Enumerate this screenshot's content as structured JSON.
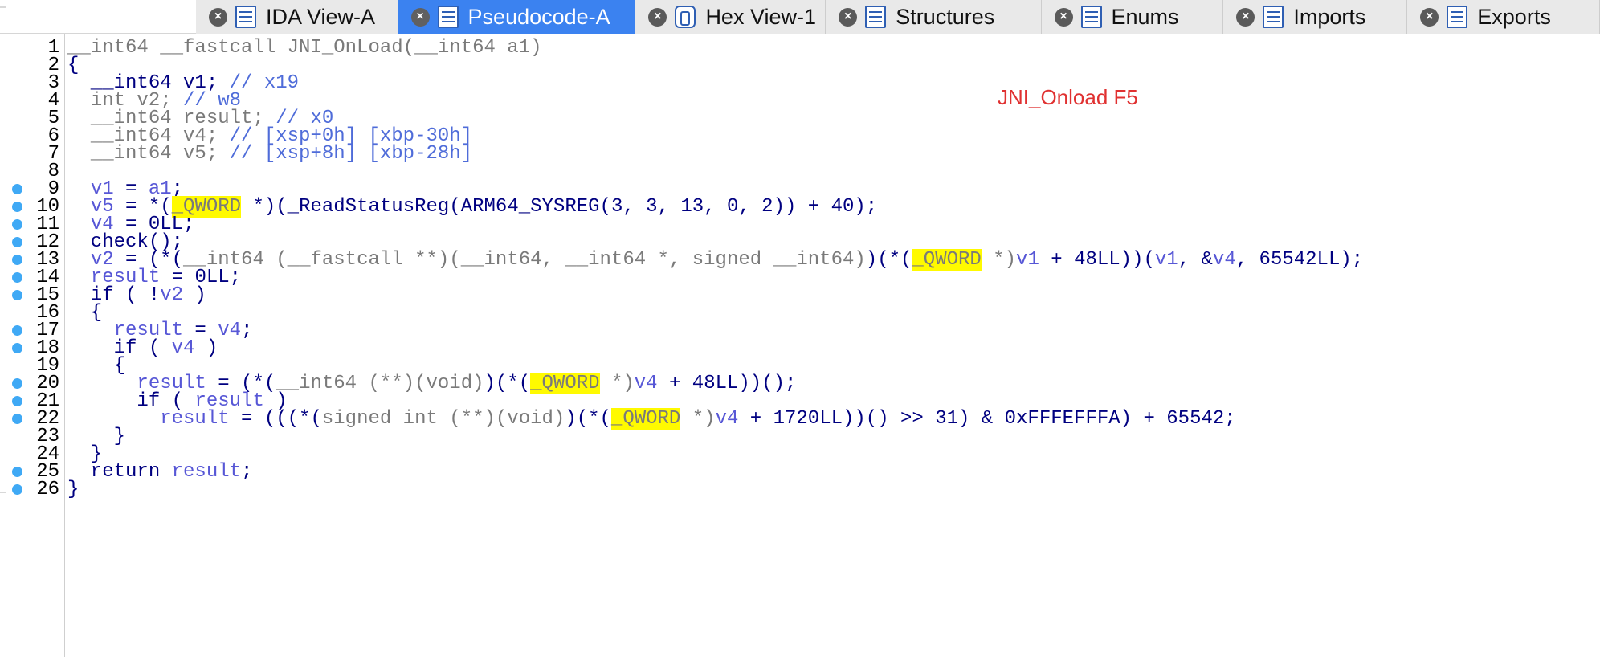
{
  "tabs": [
    {
      "label": "IDA View-A",
      "icon": "ida-view-icon",
      "active": false
    },
    {
      "label": "Pseudocode-A",
      "icon": "pseudocode-icon",
      "active": true
    },
    {
      "label": "Hex View-1",
      "icon": "hex-view-icon",
      "active": false
    },
    {
      "label": "Structures",
      "icon": "structures-icon",
      "active": false
    },
    {
      "label": "Enums",
      "icon": "enums-icon",
      "active": false
    },
    {
      "label": "Imports",
      "icon": "imports-icon",
      "active": false
    },
    {
      "label": "Exports",
      "icon": "exports-icon",
      "active": false
    }
  ],
  "annotation": "JNI_Onload F5",
  "colors": {
    "active_tab": "#3b82f0",
    "breakpoint": "#3fa9f5",
    "highlight": "#fffa00",
    "annotation": "#e03131",
    "keyword": "#000080",
    "variable": "#5757d6",
    "type": "#7a7a7a"
  },
  "code_lines": [
    {
      "n": "1",
      "bp": false,
      "tokens": [
        [
          "__int64 __fastcall JNI_OnLoad(__int64 a1)",
          "grey"
        ]
      ]
    },
    {
      "n": "2",
      "bp": false,
      "tokens": [
        [
          "{",
          "dft"
        ]
      ]
    },
    {
      "n": "3",
      "bp": false,
      "tokens": [
        [
          "  __int64 v1; ",
          "dft"
        ],
        [
          "// x19",
          "cmt"
        ]
      ]
    },
    {
      "n": "4",
      "bp": false,
      "tokens": [
        [
          "  ",
          "dft"
        ],
        [
          "int v2; ",
          "grey"
        ],
        [
          "// w8",
          "cmt"
        ]
      ]
    },
    {
      "n": "5",
      "bp": false,
      "tokens": [
        [
          "  ",
          "dft"
        ],
        [
          "__int64 result; ",
          "grey"
        ],
        [
          "// x0",
          "cmt"
        ]
      ]
    },
    {
      "n": "6",
      "bp": false,
      "tokens": [
        [
          "  ",
          "dft"
        ],
        [
          "__int64 v4; ",
          "grey"
        ],
        [
          "// [xsp+0h] [xbp-30h]",
          "cmt"
        ]
      ]
    },
    {
      "n": "7",
      "bp": false,
      "tokens": [
        [
          "  ",
          "dft"
        ],
        [
          "__int64 v5; ",
          "grey"
        ],
        [
          "// [xsp+8h] [xbp-28h]",
          "cmt"
        ]
      ]
    },
    {
      "n": "8",
      "bp": false,
      "tokens": [
        [
          "",
          "dft"
        ]
      ]
    },
    {
      "n": "9",
      "bp": true,
      "tokens": [
        [
          "  ",
          "dft"
        ],
        [
          "v1",
          "var"
        ],
        [
          " = ",
          "dft"
        ],
        [
          "a1",
          "var"
        ],
        [
          ";",
          "dft"
        ]
      ]
    },
    {
      "n": "10",
      "bp": true,
      "tokens": [
        [
          "  ",
          "dft"
        ],
        [
          "v5",
          "var"
        ],
        [
          " = *(",
          "dft"
        ],
        [
          "_QWORD",
          "hl"
        ],
        [
          " *)(_ReadStatusReg(ARM64_SYSREG(3, 3, 13, 0, 2)) + 40);",
          "dft"
        ]
      ]
    },
    {
      "n": "11",
      "bp": true,
      "tokens": [
        [
          "  ",
          "dft"
        ],
        [
          "v4",
          "var"
        ],
        [
          " = 0LL;",
          "dft"
        ]
      ]
    },
    {
      "n": "12",
      "bp": true,
      "tokens": [
        [
          "  check();",
          "dft"
        ]
      ]
    },
    {
      "n": "13",
      "bp": true,
      "tokens": [
        [
          "  ",
          "dft"
        ],
        [
          "v2",
          "var"
        ],
        [
          " = (*(",
          "dft"
        ],
        [
          "__int64 (__fastcall **)(__int64, __int64 *, signed __int64)",
          "grey"
        ],
        [
          ")(*(",
          "dft"
        ],
        [
          "_QWORD",
          "hl"
        ],
        [
          " *)",
          "grey"
        ],
        [
          "v1",
          "var"
        ],
        [
          " + 48LL))(",
          "dft"
        ],
        [
          "v1",
          "var"
        ],
        [
          ", &",
          "dft"
        ],
        [
          "v4",
          "var"
        ],
        [
          ", 65542LL);",
          "dft"
        ]
      ]
    },
    {
      "n": "14",
      "bp": true,
      "tokens": [
        [
          "  ",
          "dft"
        ],
        [
          "result",
          "var"
        ],
        [
          " = 0LL;",
          "dft"
        ]
      ]
    },
    {
      "n": "15",
      "bp": true,
      "tokens": [
        [
          "  if ( !",
          "dft"
        ],
        [
          "v2",
          "var"
        ],
        [
          " )",
          "dft"
        ]
      ]
    },
    {
      "n": "16",
      "bp": false,
      "tokens": [
        [
          "  {",
          "dft"
        ]
      ]
    },
    {
      "n": "17",
      "bp": true,
      "tokens": [
        [
          "    ",
          "dft"
        ],
        [
          "result",
          "var"
        ],
        [
          " = ",
          "dft"
        ],
        [
          "v4",
          "var"
        ],
        [
          ";",
          "dft"
        ]
      ]
    },
    {
      "n": "18",
      "bp": true,
      "tokens": [
        [
          "    if ( ",
          "dft"
        ],
        [
          "v4",
          "var"
        ],
        [
          " )",
          "dft"
        ]
      ]
    },
    {
      "n": "19",
      "bp": false,
      "tokens": [
        [
          "    {",
          "dft"
        ]
      ]
    },
    {
      "n": "20",
      "bp": true,
      "tokens": [
        [
          "      ",
          "dft"
        ],
        [
          "result",
          "var"
        ],
        [
          " = (*(",
          "dft"
        ],
        [
          "__int64 (**)(void)",
          "grey"
        ],
        [
          ")(*(",
          "dft"
        ],
        [
          "_QWORD",
          "hl"
        ],
        [
          " *)",
          "grey"
        ],
        [
          "v4",
          "var"
        ],
        [
          " + 48LL))();",
          "dft"
        ]
      ]
    },
    {
      "n": "21",
      "bp": true,
      "tokens": [
        [
          "      if ( ",
          "dft"
        ],
        [
          "result",
          "var"
        ],
        [
          " )",
          "dft"
        ]
      ]
    },
    {
      "n": "22",
      "bp": true,
      "tokens": [
        [
          "        ",
          "dft"
        ],
        [
          "result",
          "var"
        ],
        [
          " = (((*(",
          "dft"
        ],
        [
          "signed int (**)(void)",
          "grey"
        ],
        [
          ")(*(",
          "dft"
        ],
        [
          "_QWORD",
          "hl"
        ],
        [
          " *)",
          "grey"
        ],
        [
          "v4",
          "var"
        ],
        [
          " + 1720LL))() >> 31) & 0xFFFEFFFA) + 65542;",
          "dft"
        ]
      ]
    },
    {
      "n": "23",
      "bp": false,
      "tokens": [
        [
          "    }",
          "dft"
        ]
      ]
    },
    {
      "n": "24",
      "bp": false,
      "tokens": [
        [
          "  }",
          "dft"
        ]
      ]
    },
    {
      "n": "25",
      "bp": true,
      "tokens": [
        [
          "  return ",
          "dft"
        ],
        [
          "result",
          "var"
        ],
        [
          ";",
          "dft"
        ]
      ]
    },
    {
      "n": "26",
      "bp": true,
      "tokens": [
        [
          "}",
          "dft"
        ]
      ]
    }
  ]
}
